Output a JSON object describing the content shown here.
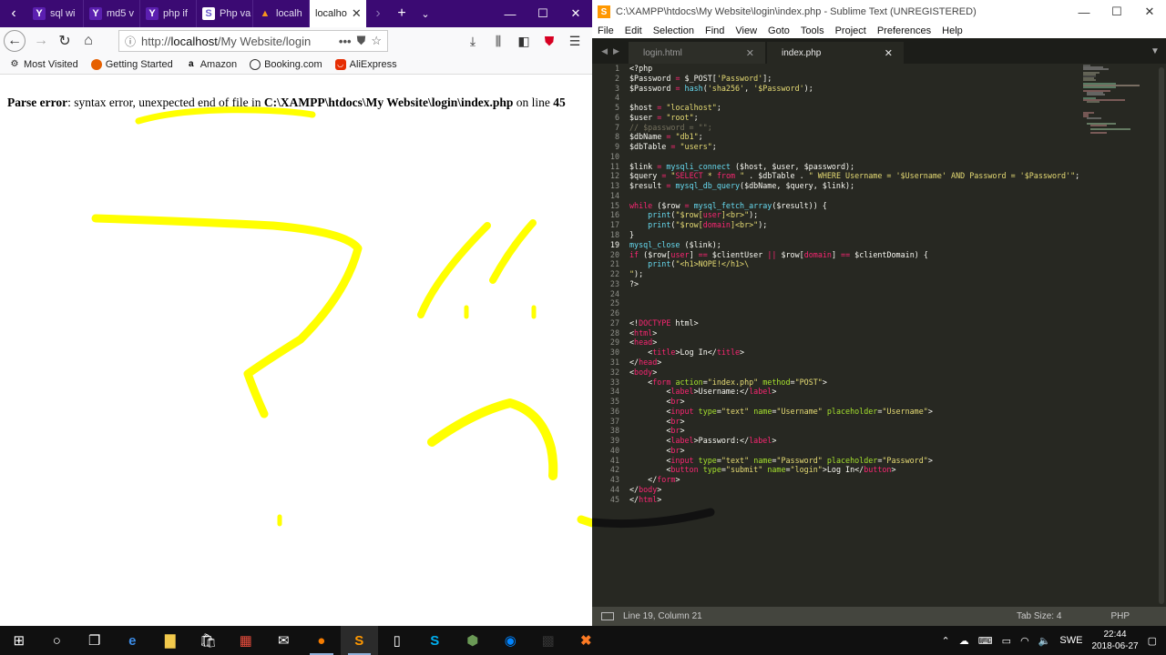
{
  "firefox": {
    "tabs": [
      {
        "label": "sql wi",
        "icon": "yahoo-icon"
      },
      {
        "label": "md5 v",
        "icon": "yahoo-icon"
      },
      {
        "label": "php if",
        "icon": "yahoo-icon"
      },
      {
        "label": "Php va",
        "icon": "php-icon"
      },
      {
        "label": "localh",
        "icon": "xampp-icon"
      },
      {
        "label": "localho",
        "icon": "none",
        "active": true
      }
    ],
    "url": {
      "prefix": "http://",
      "host": "localhost",
      "path": "/My Website/login"
    },
    "bookmarks": [
      "Most Visited",
      "Getting Started",
      "Amazon",
      "Booking.com",
      "AliExpress"
    ],
    "error": {
      "label": "Parse error",
      "message": ": syntax error, unexpected end of file in ",
      "file": "C:\\XAMPP\\htdocs\\My Website\\login\\index.php",
      "on_line": " on line ",
      "line": "45"
    }
  },
  "sublime": {
    "title": "C:\\XAMPP\\htdocs\\My Website\\login\\index.php - Sublime Text (UNREGISTERED)",
    "menu": [
      "File",
      "Edit",
      "Selection",
      "Find",
      "View",
      "Goto",
      "Tools",
      "Project",
      "Preferences",
      "Help"
    ],
    "tabs": [
      {
        "label": "login.html",
        "active": false
      },
      {
        "label": "index.php",
        "active": true
      }
    ],
    "current_line": 19,
    "status": {
      "position": "Line 19, Column 21",
      "tab_size": "Tab Size: 4",
      "syntax": "PHP"
    },
    "code": [
      [
        [
          "t",
          "<?php"
        ]
      ],
      [
        [
          "v",
          "$Password"
        ],
        [
          "t",
          " "
        ],
        [
          "k",
          "="
        ],
        [
          "t",
          " "
        ],
        [
          "v",
          "$_POST"
        ],
        [
          "t",
          "["
        ],
        [
          "s",
          "'Password'"
        ],
        [
          "t",
          "];"
        ]
      ],
      [
        [
          "v",
          "$Password"
        ],
        [
          "t",
          " "
        ],
        [
          "k",
          "="
        ],
        [
          "t",
          " "
        ],
        [
          "f",
          "hash"
        ],
        [
          "t",
          "("
        ],
        [
          "s",
          "'sha256'"
        ],
        [
          "t",
          ", "
        ],
        [
          "s",
          "'$Password'"
        ],
        [
          "t",
          ");"
        ]
      ],
      [],
      [
        [
          "v",
          "$host"
        ],
        [
          "t",
          " "
        ],
        [
          "k",
          "="
        ],
        [
          "t",
          " "
        ],
        [
          "s",
          "\"localhost\""
        ],
        [
          "t",
          ";"
        ]
      ],
      [
        [
          "v",
          "$user"
        ],
        [
          "t",
          " "
        ],
        [
          "k",
          "="
        ],
        [
          "t",
          " "
        ],
        [
          "s",
          "\"root\""
        ],
        [
          "t",
          ";"
        ]
      ],
      [
        [
          "c",
          "// $password = \"\";"
        ]
      ],
      [
        [
          "v",
          "$dbName"
        ],
        [
          "t",
          " "
        ],
        [
          "k",
          "="
        ],
        [
          "t",
          " "
        ],
        [
          "s",
          "\"db1\""
        ],
        [
          "t",
          ";"
        ]
      ],
      [
        [
          "v",
          "$dbTable"
        ],
        [
          "t",
          " "
        ],
        [
          "k",
          "="
        ],
        [
          "t",
          " "
        ],
        [
          "s",
          "\"users\""
        ],
        [
          "t",
          ";"
        ]
      ],
      [],
      [
        [
          "v",
          "$link"
        ],
        [
          "t",
          " "
        ],
        [
          "k",
          "="
        ],
        [
          "t",
          " "
        ],
        [
          "f",
          "mysqli_connect"
        ],
        [
          "t",
          " ($host, $user, $password);"
        ]
      ],
      [
        [
          "v",
          "$query"
        ],
        [
          "t",
          " "
        ],
        [
          "k",
          "="
        ],
        [
          "t",
          " "
        ],
        [
          "s",
          "\""
        ],
        [
          "k",
          "SELECT"
        ],
        [
          "s",
          " * "
        ],
        [
          "k",
          "from"
        ],
        [
          "s",
          " \""
        ],
        [
          "t",
          " . $dbTable . "
        ],
        [
          "s",
          "\" WHERE Username = '$Username' AND Password = '$Password'\""
        ],
        [
          "t",
          ";"
        ]
      ],
      [
        [
          "v",
          "$result"
        ],
        [
          "t",
          " "
        ],
        [
          "k",
          "="
        ],
        [
          "t",
          " "
        ],
        [
          "f",
          "mysql_db_query"
        ],
        [
          "t",
          "($dbName, $query, $link);"
        ]
      ],
      [],
      [
        [
          "k",
          "while"
        ],
        [
          "t",
          " ("
        ],
        [
          "v",
          "$row"
        ],
        [
          "t",
          " "
        ],
        [
          "k",
          "="
        ],
        [
          "t",
          " "
        ],
        [
          "f",
          "mysql_fetch_array"
        ],
        [
          "t",
          "($result)) {"
        ]
      ],
      [
        [
          "t",
          "    "
        ],
        [
          "f",
          "print"
        ],
        [
          "t",
          "("
        ],
        [
          "s",
          "\"$row["
        ],
        [
          "k",
          "user"
        ],
        [
          "s",
          "]<br>\""
        ],
        [
          "t",
          ");"
        ]
      ],
      [
        [
          "t",
          "    "
        ],
        [
          "f",
          "print"
        ],
        [
          "t",
          "("
        ],
        [
          "s",
          "\"$row["
        ],
        [
          "k",
          "domain"
        ],
        [
          "s",
          "]<br>\""
        ],
        [
          "t",
          ");"
        ]
      ],
      [
        [
          "t",
          "}"
        ]
      ],
      [
        [
          "f",
          "mysql_close"
        ],
        [
          "t",
          " ($link);"
        ]
      ],
      [
        [
          "k",
          "if"
        ],
        [
          "t",
          " ("
        ],
        [
          "v",
          "$row"
        ],
        [
          "t",
          "["
        ],
        [
          "k",
          "user"
        ],
        [
          "t",
          "] "
        ],
        [
          "k",
          "=="
        ],
        [
          "t",
          " $clientUser "
        ],
        [
          "k",
          "||"
        ],
        [
          "t",
          " $row["
        ],
        [
          "k",
          "domain"
        ],
        [
          "t",
          "] "
        ],
        [
          "k",
          "=="
        ],
        [
          "t",
          " $clientDomain) {"
        ]
      ],
      [
        [
          "t",
          "    "
        ],
        [
          "f",
          "print"
        ],
        [
          "t",
          "("
        ],
        [
          "s",
          "\"<h1>NOPE!</h1>\\"
        ]
      ],
      [
        [
          "s",
          "\""
        ],
        [
          "t",
          ");"
        ]
      ],
      [
        [
          "t",
          "?>"
        ]
      ],
      [],
      [],
      [],
      [
        [
          "t",
          "<!"
        ],
        [
          "k",
          "DOCTYPE"
        ],
        [
          "t",
          " html>"
        ]
      ],
      [
        [
          "t",
          "<"
        ],
        [
          "k",
          "html"
        ],
        [
          "t",
          ">"
        ]
      ],
      [
        [
          "t",
          "<"
        ],
        [
          "k",
          "head"
        ],
        [
          "t",
          ">"
        ]
      ],
      [
        [
          "t",
          "    <"
        ],
        [
          "k",
          "title"
        ],
        [
          "t",
          ">Log In</"
        ],
        [
          "k",
          "title"
        ],
        [
          "t",
          ">"
        ]
      ],
      [
        [
          "t",
          "</"
        ],
        [
          "k",
          "head"
        ],
        [
          "t",
          ">"
        ]
      ],
      [
        [
          "t",
          "<"
        ],
        [
          "k",
          "body"
        ],
        [
          "t",
          ">"
        ]
      ],
      [
        [
          "t",
          "    <"
        ],
        [
          "k",
          "form"
        ],
        [
          "t",
          " "
        ],
        [
          "a",
          "action"
        ],
        [
          "t",
          "="
        ],
        [
          "s",
          "\"index.php\""
        ],
        [
          "t",
          " "
        ],
        [
          "a",
          "method"
        ],
        [
          "t",
          "="
        ],
        [
          "s",
          "\"POST\""
        ],
        [
          "t",
          ">"
        ]
      ],
      [
        [
          "t",
          "        <"
        ],
        [
          "k",
          "label"
        ],
        [
          "t",
          ">Username:</"
        ],
        [
          "k",
          "label"
        ],
        [
          "t",
          ">"
        ]
      ],
      [
        [
          "t",
          "        <"
        ],
        [
          "k",
          "br"
        ],
        [
          "t",
          ">"
        ]
      ],
      [
        [
          "t",
          "        <"
        ],
        [
          "k",
          "input"
        ],
        [
          "t",
          " "
        ],
        [
          "a",
          "type"
        ],
        [
          "t",
          "="
        ],
        [
          "s",
          "\"text\""
        ],
        [
          "t",
          " "
        ],
        [
          "a",
          "name"
        ],
        [
          "t",
          "="
        ],
        [
          "s",
          "\"Username\""
        ],
        [
          "t",
          " "
        ],
        [
          "a",
          "placeholder"
        ],
        [
          "t",
          "="
        ],
        [
          "s",
          "\"Username\""
        ],
        [
          "t",
          ">"
        ]
      ],
      [
        [
          "t",
          "        <"
        ],
        [
          "k",
          "br"
        ],
        [
          "t",
          ">"
        ]
      ],
      [
        [
          "t",
          "        <"
        ],
        [
          "k",
          "br"
        ],
        [
          "t",
          ">"
        ]
      ],
      [
        [
          "t",
          "        <"
        ],
        [
          "k",
          "label"
        ],
        [
          "t",
          ">Password:</"
        ],
        [
          "k",
          "label"
        ],
        [
          "t",
          ">"
        ]
      ],
      [
        [
          "t",
          "        <"
        ],
        [
          "k",
          "br"
        ],
        [
          "t",
          ">"
        ]
      ],
      [
        [
          "t",
          "        <"
        ],
        [
          "k",
          "input"
        ],
        [
          "t",
          " "
        ],
        [
          "a",
          "type"
        ],
        [
          "t",
          "="
        ],
        [
          "s",
          "\"text\""
        ],
        [
          "t",
          " "
        ],
        [
          "a",
          "name"
        ],
        [
          "t",
          "="
        ],
        [
          "s",
          "\"Password\""
        ],
        [
          "t",
          " "
        ],
        [
          "a",
          "placeholder"
        ],
        [
          "t",
          "="
        ],
        [
          "s",
          "\"Password\""
        ],
        [
          "t",
          ">"
        ]
      ],
      [
        [
          "t",
          "        <"
        ],
        [
          "k",
          "button"
        ],
        [
          "t",
          " "
        ],
        [
          "a",
          "type"
        ],
        [
          "t",
          "="
        ],
        [
          "s",
          "\"submit\""
        ],
        [
          "t",
          " "
        ],
        [
          "a",
          "name"
        ],
        [
          "t",
          "="
        ],
        [
          "s",
          "\"login\""
        ],
        [
          "t",
          ">Log In</"
        ],
        [
          "k",
          "button"
        ],
        [
          "t",
          ">"
        ]
      ],
      [
        [
          "t",
          "    </"
        ],
        [
          "k",
          "form"
        ],
        [
          "t",
          ">"
        ]
      ],
      [
        [
          "t",
          "</"
        ],
        [
          "k",
          "body"
        ],
        [
          "t",
          ">"
        ]
      ],
      [
        [
          "t",
          "</"
        ],
        [
          "k",
          "html"
        ],
        [
          "t",
          ">"
        ]
      ]
    ],
    "syntax_colors": {
      "t": "#f8f8f2",
      "k": "#f92672",
      "s": "#e6db74",
      "v": "#f8f8f2",
      "f": "#66d9ef",
      "c": "#75715e",
      "a": "#a6e22e"
    }
  },
  "taskbar": {
    "apps": [
      "windows-start-icon",
      "cortana-icon",
      "task-view-icon",
      "edge-icon",
      "file-explorer-icon",
      "store-icon",
      "gift-icon",
      "mail-icon",
      "firefox-icon",
      "sublime-text-icon",
      "document-icon",
      "skype-icon",
      "app-icon",
      "messenger-icon",
      "calculator-icon",
      "xampp-icon"
    ],
    "language": "SWE",
    "time": "22:44",
    "date": "2018-06-27"
  },
  "scribble_color": "#ffff00",
  "underline_color": "#111111"
}
